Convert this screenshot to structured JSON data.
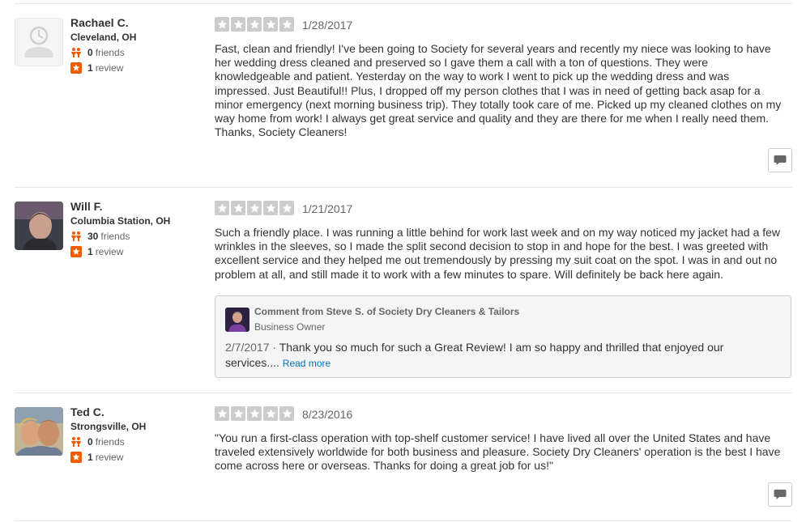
{
  "reviews": [
    {
      "user": {
        "name": "Rachael C.",
        "location": "Cleveland, OH",
        "friends": "0",
        "friends_label": "friends",
        "reviews": "1",
        "reviews_label": "review",
        "avatar": "default-avatar"
      },
      "rating": 5,
      "date": "1/28/2017",
      "text": "Fast, clean and friendly! I've been going to Society for several years and recently my niece was looking to have her wedding dress cleaned and preserved so I gave them a call with a ton of questions. They were knowledgeable and patient. Yesterday on the way to work I went to pick up the wedding dress and was impressed. Just Beautiful!! Plus, I dropped off my person clothes that I was in need of getting back asap for a minor emergency (next morning business trip). They totally took care of me. Picked up my cleaned clothes on my way home from work! I always get great service and quality and they are there for me when I really need them. Thanks, Society Cleaners!"
    },
    {
      "user": {
        "name": "Will F.",
        "location": "Columbia Station, OH",
        "friends": "30",
        "friends_label": "friends",
        "reviews": "1",
        "reviews_label": "review",
        "avatar": "user-photo"
      },
      "rating": 5,
      "date": "1/21/2017",
      "text": "Such a friendly place. I was running a little behind for work last week and on my way noticed my jacket had a few wrinkles in the sleeves, so I made the split second decision to stop in and hope for the best. I was greeted with excellent service and they helped me out tremendously by pressing my suit coat on the spot. I was in and out no problem at all, and still made it to work with a few minutes to spare. Will definitely be back here again.",
      "comment": {
        "title": "Comment from Steve S. of Society Dry Cleaners & Tailors",
        "role": "Business Owner",
        "date": "2/7/2017",
        "separator": " · ",
        "text": "Thank you so much for such a Great Review! I am so happy and thrilled that enjoyed our services.... ",
        "read_more": "Read more"
      }
    },
    {
      "user": {
        "name": "Ted C.",
        "location": "Strongsville, OH",
        "friends": "0",
        "friends_label": "friends",
        "reviews": "1",
        "reviews_label": "review",
        "avatar": "user-photo"
      },
      "rating": 5,
      "date": "8/23/2016",
      "text": "\"You run a first-class operation with top-shelf customer service! I have lived all over the United States and have traveled extensively worldwide for both business and pleasure. Society Dry Cleaners' operation is the best I have come across here or overseas. Thanks for doing a great job for us!\""
    }
  ],
  "icons": {
    "star": "star-icon",
    "friends": "friends-icon",
    "review": "review-star-icon",
    "comment": "speech-bubble-icon"
  },
  "colors": {
    "star_empty": "#cccccc",
    "friends_icon": "#f15c00",
    "review_icon": "#f15c00",
    "link": "#0073bb"
  }
}
